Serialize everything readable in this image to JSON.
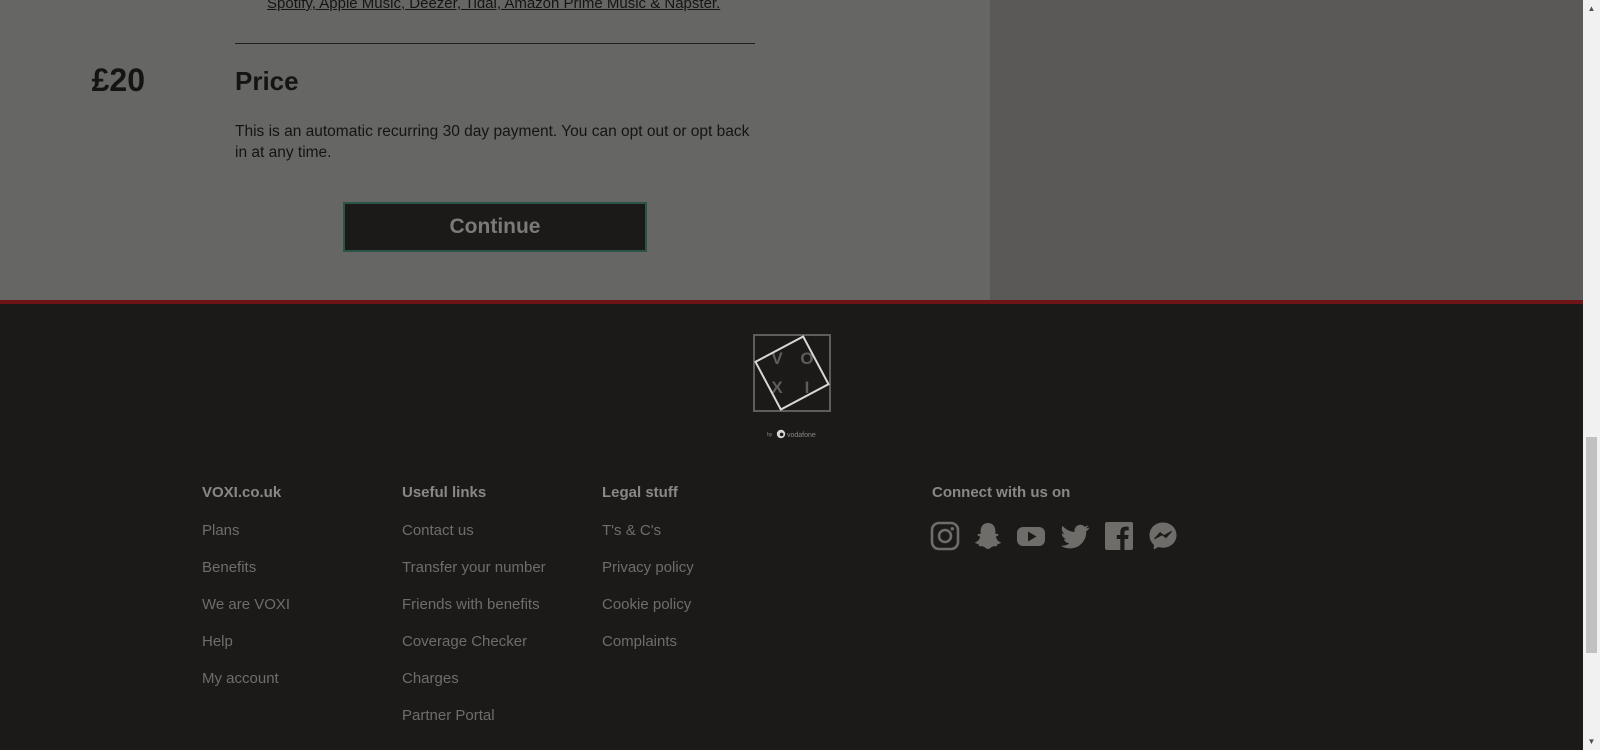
{
  "plan": {
    "streaming_services": "Spotify, Apple Music, Deezer, Tidal, Amazon Prime Music & Napster.",
    "price_label": "Price",
    "price_value": "£20",
    "price_note": "This is an automatic recurring 30 day payment. You can opt out or opt back in at any time.",
    "continue_label": "Continue"
  },
  "logo": {
    "letters": [
      "V",
      "O",
      "X",
      "I"
    ],
    "by": "by",
    "brand": "vodafone"
  },
  "footer": {
    "columns": [
      {
        "title": "VOXI.co.uk",
        "links": [
          "Plans",
          "Benefits",
          "We are VOXI",
          "Help",
          "My account"
        ]
      },
      {
        "title": "Useful links",
        "links": [
          "Contact us",
          "Transfer your number",
          "Friends with benefits",
          "Coverage Checker",
          "Charges",
          "Partner Portal"
        ]
      },
      {
        "title": "Legal stuff",
        "links": [
          "T's & C's",
          "Privacy policy",
          "Cookie policy",
          "Complaints"
        ]
      }
    ],
    "social": {
      "title": "Connect with us on",
      "icons": [
        "instagram-icon",
        "snapchat-icon",
        "youtube-icon",
        "twitter-icon",
        "facebook-icon",
        "messenger-icon"
      ]
    }
  },
  "colors": {
    "accent_rule": "#6f1416",
    "footer_bg": "#1b1a18",
    "overlay_left": "#666664",
    "overlay_right": "#5a5958"
  }
}
